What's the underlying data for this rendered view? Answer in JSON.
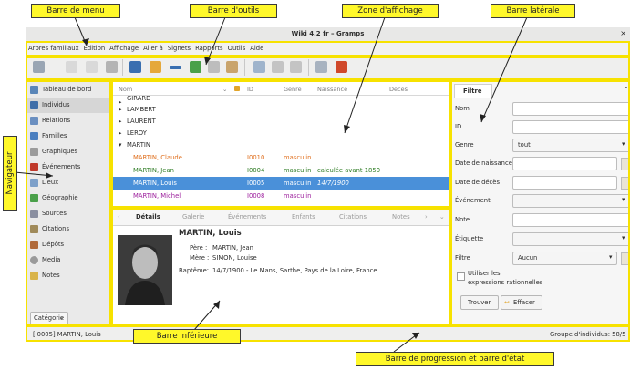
{
  "window": {
    "title": "Wiki 4.2 fr – Gramps",
    "close_glyph": "×"
  },
  "menu": [
    "Arbres familiaux",
    "Édition",
    "Affichage",
    "Aller à",
    "Signets",
    "Rapports",
    "Outils",
    "Aide"
  ],
  "annotations": {
    "menubar": "Barre de menu",
    "toolbar": "Barre d'outils",
    "display_zone": "Zone d'affichage",
    "sidebar": "Barre latérale",
    "navigator": "Navigateur",
    "bottombar": "Barre inférieure",
    "progress": "Barre de progression et barre d'état"
  },
  "navigator": {
    "items": [
      "Tableau de bord",
      "Individus",
      "Relations",
      "Familles",
      "Graphiques",
      "Événements",
      "Lieux",
      "Géographie",
      "Sources",
      "Citations",
      "Dépôts",
      "Media",
      "Notes"
    ],
    "category_button": "Catégorie",
    "selected_index": 1
  },
  "people_list": {
    "columns": [
      "Nom",
      "ID",
      "Genre",
      "Naissance",
      "Décès"
    ],
    "groups": [
      {
        "name": "GIRARD",
        "glyph": "▸"
      },
      {
        "name": "LAMBERT",
        "glyph": "▸"
      },
      {
        "name": "LAURENT",
        "glyph": "▸"
      },
      {
        "name": "LEROY",
        "glyph": "▸"
      },
      {
        "name": "MARTIN",
        "glyph": "▾"
      }
    ],
    "rows": [
      {
        "name": "MARTIN, Claude",
        "id": "I0010",
        "gender": "masculin",
        "birth": "",
        "color": "#e0701f"
      },
      {
        "name": "MARTIN, Jean",
        "id": "I0004",
        "gender": "masculin",
        "birth": "calculée avant 1850",
        "color": "#2f7d25"
      },
      {
        "name": "MARTIN, Louis",
        "id": "I0005",
        "gender": "masculin",
        "birth": "14/7/1900",
        "color": "#ffffff"
      },
      {
        "name": "MARTIN, Michel",
        "id": "I0008",
        "gender": "masculin",
        "birth": "",
        "color": "#9c1f9c"
      }
    ],
    "selected_row": 2
  },
  "bottom_tabs": [
    "Détails",
    "Galerie",
    "Événements",
    "Enfants",
    "Citations",
    "Notes"
  ],
  "details": {
    "name": "MARTIN, Louis",
    "father_label": "Père :",
    "father": "MARTIN, Jean",
    "mother_label": "Mère :",
    "mother": "SIMON, Louise",
    "baptism_label": "Baptême:",
    "baptism": "14/7/1900 - Le Mans, Sarthe, Pays de la Loire, France."
  },
  "filter": {
    "tab": "Filtre",
    "fields": [
      "Nom",
      "ID",
      "Genre",
      "Date de naissance",
      "Date de décès",
      "Événement",
      "Note",
      "Étiquette",
      "Filtre"
    ],
    "gender_value": "tout",
    "filter_value": "Aucun",
    "regex_label_1": "Utiliser les",
    "regex_label_2": "expressions rationnelles",
    "find_button": "Trouver",
    "clear_button": "Effacer"
  },
  "status": {
    "left": "[I0005] MARTIN, Louis",
    "right": "Groupe d'individus: 58/5"
  },
  "colors": {
    "annotation_fill": "#fff82a",
    "frame": "#f7e200",
    "selection": "#4a90d9"
  }
}
